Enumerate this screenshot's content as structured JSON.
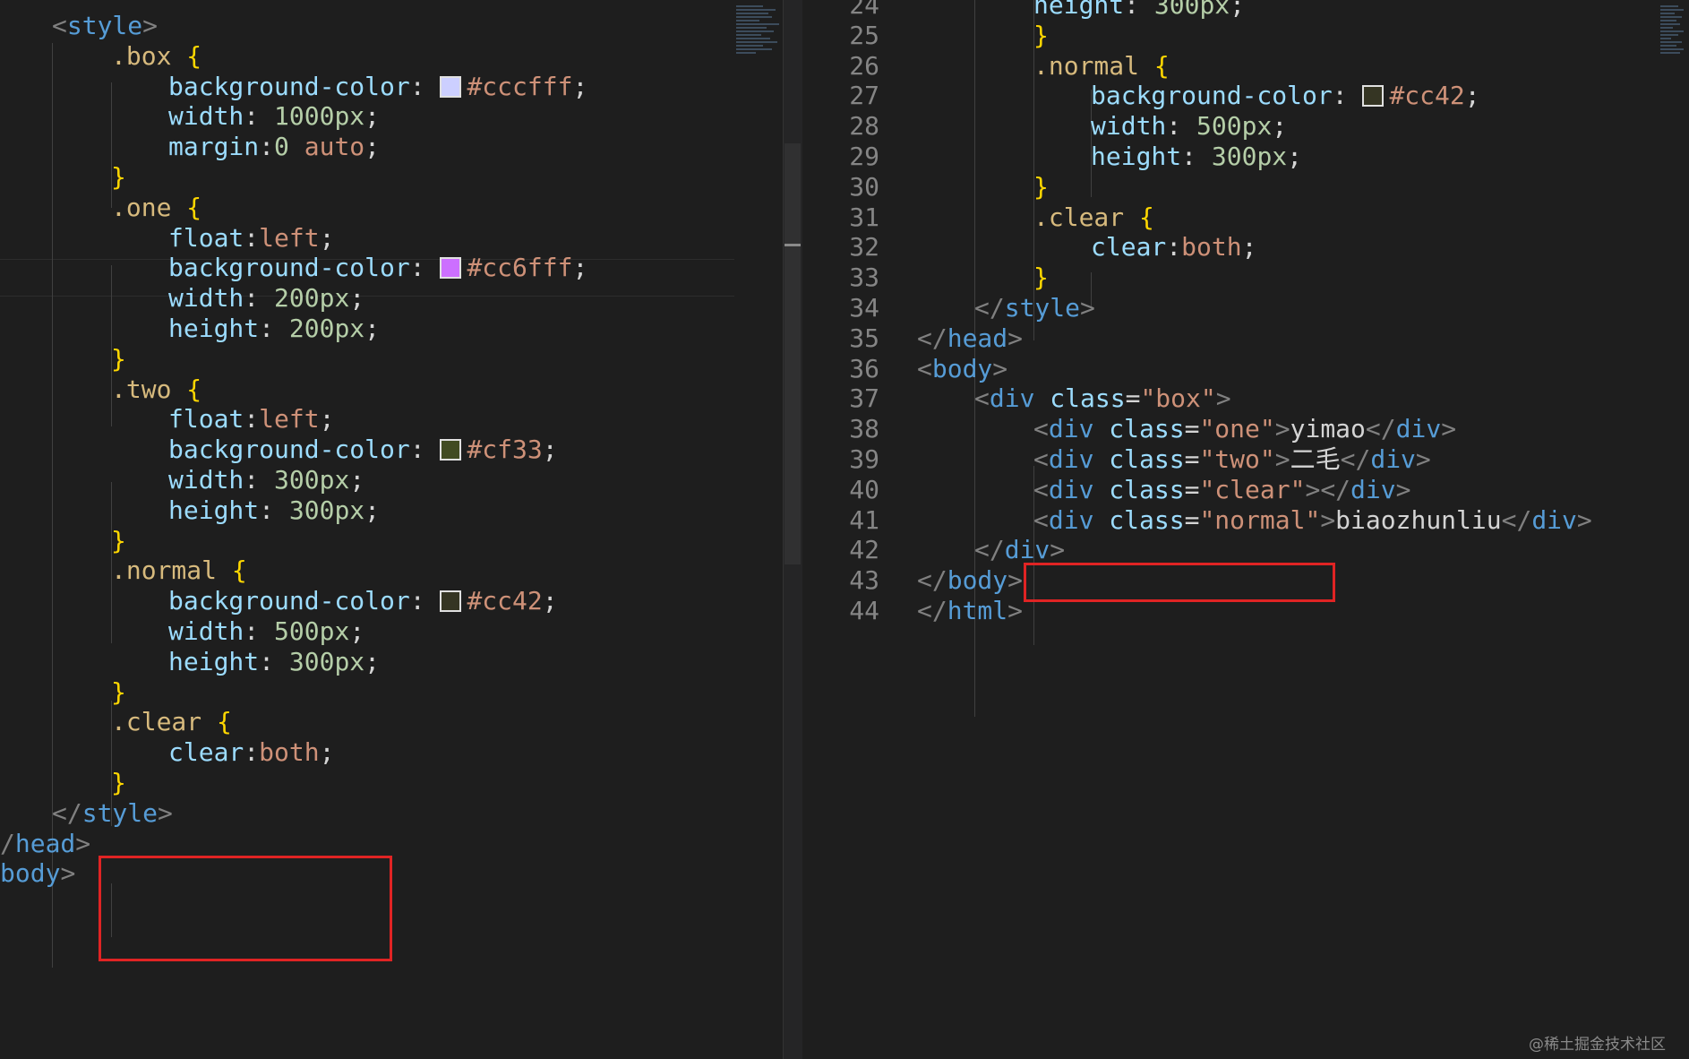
{
  "left_editor": {
    "lines": [
      {
        "tokens": [
          {
            "t": "<",
            "c": "punc"
          },
          {
            "t": "style",
            "c": "tag"
          },
          {
            "t": ">",
            "c": "punc"
          }
        ]
      },
      {
        "tokens": [
          {
            "t": ".box",
            "c": "sel"
          },
          {
            "t": " ",
            "c": "txt"
          },
          {
            "t": "{",
            "c": "brace"
          }
        ]
      },
      {
        "tokens": [
          {
            "t": "background-color",
            "c": "prop"
          },
          {
            "t": ": ",
            "c": "txt"
          },
          {
            "t": "#cccfff",
            "c": "val",
            "swatch": "#cccfff"
          },
          {
            "t": ";",
            "c": "txt"
          }
        ]
      },
      {
        "tokens": [
          {
            "t": "width",
            "c": "prop"
          },
          {
            "t": ": ",
            "c": "txt"
          },
          {
            "t": "1000px",
            "c": "num"
          },
          {
            "t": ";",
            "c": "txt"
          }
        ]
      },
      {
        "tokens": [
          {
            "t": "margin",
            "c": "prop"
          },
          {
            "t": ":",
            "c": "txt"
          },
          {
            "t": "0",
            "c": "num"
          },
          {
            "t": " auto",
            "c": "val"
          },
          {
            "t": ";",
            "c": "txt"
          }
        ]
      },
      {
        "tokens": [
          {
            "t": "}",
            "c": "brace"
          }
        ]
      },
      {
        "tokens": [
          {
            "t": ".one",
            "c": "sel"
          },
          {
            "t": " ",
            "c": "txt"
          },
          {
            "t": "{",
            "c": "brace"
          }
        ]
      },
      {
        "tokens": [
          {
            "t": "float",
            "c": "prop"
          },
          {
            "t": ":",
            "c": "txt"
          },
          {
            "t": "left",
            "c": "val"
          },
          {
            "t": ";",
            "c": "txt"
          }
        ]
      },
      {
        "tokens": [
          {
            "t": "background-color",
            "c": "prop"
          },
          {
            "t": ": ",
            "c": "txt"
          },
          {
            "t": "#cc6fff",
            "c": "val",
            "swatch": "#cc6fff"
          },
          {
            "t": ";",
            "c": "txt"
          }
        ]
      },
      {
        "tokens": [
          {
            "t": "width",
            "c": "prop"
          },
          {
            "t": ": ",
            "c": "txt"
          },
          {
            "t": "200px",
            "c": "num"
          },
          {
            "t": ";",
            "c": "txt"
          }
        ]
      },
      {
        "tokens": [
          {
            "t": "height",
            "c": "prop"
          },
          {
            "t": ": ",
            "c": "txt"
          },
          {
            "t": "200px",
            "c": "num"
          },
          {
            "t": ";",
            "c": "txt"
          }
        ]
      },
      {
        "tokens": [
          {
            "t": "}",
            "c": "brace"
          }
        ]
      },
      {
        "tokens": [
          {
            "t": ".two",
            "c": "sel"
          },
          {
            "t": " ",
            "c": "txt"
          },
          {
            "t": "{",
            "c": "brace"
          }
        ]
      },
      {
        "tokens": [
          {
            "t": "float",
            "c": "prop"
          },
          {
            "t": ":",
            "c": "txt"
          },
          {
            "t": "left",
            "c": "val"
          },
          {
            "t": ";",
            "c": "txt"
          }
        ]
      },
      {
        "tokens": [
          {
            "t": "background-color",
            "c": "prop"
          },
          {
            "t": ": ",
            "c": "txt"
          },
          {
            "t": "#cf33",
            "c": "val",
            "swatch": "#ccff3333"
          },
          {
            "t": ";",
            "c": "txt"
          }
        ]
      },
      {
        "tokens": [
          {
            "t": "width",
            "c": "prop"
          },
          {
            "t": ": ",
            "c": "txt"
          },
          {
            "t": "300px",
            "c": "num"
          },
          {
            "t": ";",
            "c": "txt"
          }
        ]
      },
      {
        "tokens": [
          {
            "t": "height",
            "c": "prop"
          },
          {
            "t": ": ",
            "c": "txt"
          },
          {
            "t": "300px",
            "c": "num"
          },
          {
            "t": ";",
            "c": "txt"
          }
        ]
      },
      {
        "tokens": [
          {
            "t": "}",
            "c": "brace"
          }
        ]
      },
      {
        "tokens": [
          {
            "t": ".normal",
            "c": "sel"
          },
          {
            "t": " ",
            "c": "txt"
          },
          {
            "t": "{",
            "c": "brace"
          }
        ]
      },
      {
        "tokens": [
          {
            "t": "background-color",
            "c": "prop"
          },
          {
            "t": ": ",
            "c": "txt"
          },
          {
            "t": "#cc42",
            "c": "val",
            "swatch": "#cccc4422"
          },
          {
            "t": ";",
            "c": "txt"
          }
        ]
      },
      {
        "tokens": [
          {
            "t": "width",
            "c": "prop"
          },
          {
            "t": ": ",
            "c": "txt"
          },
          {
            "t": "500px",
            "c": "num"
          },
          {
            "t": ";",
            "c": "txt"
          }
        ]
      },
      {
        "tokens": [
          {
            "t": "height",
            "c": "prop"
          },
          {
            "t": ": ",
            "c": "txt"
          },
          {
            "t": "300px",
            "c": "num"
          },
          {
            "t": ";",
            "c": "txt"
          }
        ]
      },
      {
        "tokens": [
          {
            "t": "}",
            "c": "brace"
          }
        ]
      },
      {
        "tokens": [
          {
            "t": ".clear",
            "c": "sel"
          },
          {
            "t": " ",
            "c": "txt"
          },
          {
            "t": "{",
            "c": "brace"
          }
        ]
      },
      {
        "tokens": [
          {
            "t": "clear",
            "c": "prop"
          },
          {
            "t": ":",
            "c": "txt"
          },
          {
            "t": "both",
            "c": "val"
          },
          {
            "t": ";",
            "c": "txt"
          }
        ]
      },
      {
        "tokens": [
          {
            "t": "}",
            "c": "brace"
          }
        ]
      },
      {
        "tokens": [
          {
            "t": "</",
            "c": "punc"
          },
          {
            "t": "style",
            "c": "tag"
          },
          {
            "t": ">",
            "c": "punc"
          }
        ]
      },
      {
        "tokens": [
          {
            "t": "/",
            "c": "punc"
          },
          {
            "t": "head",
            "c": "tag"
          },
          {
            "t": ">",
            "c": "punc"
          }
        ]
      },
      {
        "tokens": [
          {
            "t": "body",
            "c": "tag"
          },
          {
            "t": ">",
            "c": "punc"
          }
        ]
      }
    ]
  },
  "right_editor": {
    "lines": [
      {
        "num": "24",
        "tokens": [
          {
            "t": "height",
            "c": "prop"
          },
          {
            "t": ": ",
            "c": "txt"
          },
          {
            "t": "300px",
            "c": "num"
          },
          {
            "t": ";",
            "c": "txt"
          }
        ]
      },
      {
        "num": "25",
        "tokens": [
          {
            "t": "}",
            "c": "brace"
          }
        ]
      },
      {
        "num": "26",
        "tokens": [
          {
            "t": ".normal",
            "c": "sel"
          },
          {
            "t": " ",
            "c": "txt"
          },
          {
            "t": "{",
            "c": "brace"
          }
        ]
      },
      {
        "num": "27",
        "tokens": [
          {
            "t": "background-color",
            "c": "prop"
          },
          {
            "t": ": ",
            "c": "txt"
          },
          {
            "t": "#cc42",
            "c": "val",
            "swatch": "#cccc4422"
          },
          {
            "t": ";",
            "c": "txt"
          }
        ]
      },
      {
        "num": "28",
        "tokens": [
          {
            "t": "width",
            "c": "prop"
          },
          {
            "t": ": ",
            "c": "txt"
          },
          {
            "t": "500px",
            "c": "num"
          },
          {
            "t": ";",
            "c": "txt"
          }
        ]
      },
      {
        "num": "29",
        "tokens": [
          {
            "t": "height",
            "c": "prop"
          },
          {
            "t": ": ",
            "c": "txt"
          },
          {
            "t": "300px",
            "c": "num"
          },
          {
            "t": ";",
            "c": "txt"
          }
        ]
      },
      {
        "num": "30",
        "tokens": [
          {
            "t": "}",
            "c": "brace"
          }
        ]
      },
      {
        "num": "31",
        "tokens": [
          {
            "t": ".clear",
            "c": "sel"
          },
          {
            "t": " ",
            "c": "txt"
          },
          {
            "t": "{",
            "c": "brace"
          }
        ]
      },
      {
        "num": "32",
        "tokens": [
          {
            "t": "clear",
            "c": "prop"
          },
          {
            "t": ":",
            "c": "txt"
          },
          {
            "t": "both",
            "c": "val"
          },
          {
            "t": ";",
            "c": "txt"
          }
        ]
      },
      {
        "num": "33",
        "tokens": [
          {
            "t": "}",
            "c": "brace"
          }
        ]
      },
      {
        "num": "34",
        "tokens": [
          {
            "t": "</",
            "c": "punc"
          },
          {
            "t": "style",
            "c": "tag"
          },
          {
            "t": ">",
            "c": "punc"
          }
        ]
      },
      {
        "num": "35",
        "tokens": [
          {
            "t": "</",
            "c": "punc"
          },
          {
            "t": "head",
            "c": "tag"
          },
          {
            "t": ">",
            "c": "punc"
          }
        ]
      },
      {
        "num": "36",
        "tokens": [
          {
            "t": "<",
            "c": "punc"
          },
          {
            "t": "body",
            "c": "tag"
          },
          {
            "t": ">",
            "c": "punc"
          }
        ]
      },
      {
        "num": "37",
        "tokens": [
          {
            "t": "<",
            "c": "punc"
          },
          {
            "t": "div",
            "c": "tag"
          },
          {
            "t": " ",
            "c": "txt"
          },
          {
            "t": "class",
            "c": "attr"
          },
          {
            "t": "=",
            "c": "txt"
          },
          {
            "t": "\"box\"",
            "c": "str"
          },
          {
            "t": ">",
            "c": "punc"
          }
        ]
      },
      {
        "num": "38",
        "tokens": [
          {
            "t": "<",
            "c": "punc"
          },
          {
            "t": "div",
            "c": "tag"
          },
          {
            "t": " ",
            "c": "txt"
          },
          {
            "t": "class",
            "c": "attr"
          },
          {
            "t": "=",
            "c": "txt"
          },
          {
            "t": "\"one\"",
            "c": "str"
          },
          {
            "t": ">",
            "c": "punc"
          },
          {
            "t": "yimao",
            "c": "txt"
          },
          {
            "t": "</",
            "c": "punc"
          },
          {
            "t": "div",
            "c": "tag"
          },
          {
            "t": ">",
            "c": "punc"
          }
        ]
      },
      {
        "num": "39",
        "tokens": [
          {
            "t": "<",
            "c": "punc"
          },
          {
            "t": "div",
            "c": "tag"
          },
          {
            "t": " ",
            "c": "txt"
          },
          {
            "t": "class",
            "c": "attr"
          },
          {
            "t": "=",
            "c": "txt"
          },
          {
            "t": "\"two\"",
            "c": "str"
          },
          {
            "t": ">",
            "c": "punc"
          },
          {
            "t": "二毛",
            "c": "txt"
          },
          {
            "t": "</",
            "c": "punc"
          },
          {
            "t": "div",
            "c": "tag"
          },
          {
            "t": ">",
            "c": "punc"
          }
        ]
      },
      {
        "num": "40",
        "tokens": [
          {
            "t": "<",
            "c": "punc"
          },
          {
            "t": "div",
            "c": "tag"
          },
          {
            "t": " ",
            "c": "txt"
          },
          {
            "t": "class",
            "c": "attr"
          },
          {
            "t": "=",
            "c": "txt"
          },
          {
            "t": "\"clear\"",
            "c": "str"
          },
          {
            "t": "></",
            "c": "punc"
          },
          {
            "t": "div",
            "c": "tag"
          },
          {
            "t": ">",
            "c": "punc"
          }
        ]
      },
      {
        "num": "41",
        "tokens": [
          {
            "t": "<",
            "c": "punc"
          },
          {
            "t": "div",
            "c": "tag"
          },
          {
            "t": " ",
            "c": "txt"
          },
          {
            "t": "class",
            "c": "attr"
          },
          {
            "t": "=",
            "c": "txt"
          },
          {
            "t": "\"normal\"",
            "c": "str"
          },
          {
            "t": ">",
            "c": "punc"
          },
          {
            "t": "biaozhunliu",
            "c": "txt"
          },
          {
            "t": "</",
            "c": "punc"
          },
          {
            "t": "div",
            "c": "tag"
          },
          {
            "t": ">",
            "c": "punc"
          }
        ]
      },
      {
        "num": "42",
        "tokens": [
          {
            "t": "</",
            "c": "punc"
          },
          {
            "t": "div",
            "c": "tag"
          },
          {
            "t": ">",
            "c": "punc"
          }
        ]
      },
      {
        "num": "43",
        "tokens": [
          {
            "t": "</",
            "c": "punc"
          },
          {
            "t": "body",
            "c": "tag"
          },
          {
            "t": ">",
            "c": "punc"
          }
        ]
      },
      {
        "num": "44",
        "tokens": [
          {
            "t": "</",
            "c": "punc"
          },
          {
            "t": "html",
            "c": "tag"
          },
          {
            "t": ">",
            "c": "punc"
          }
        ]
      }
    ]
  },
  "watermark": "@稀土掘金技术社区"
}
